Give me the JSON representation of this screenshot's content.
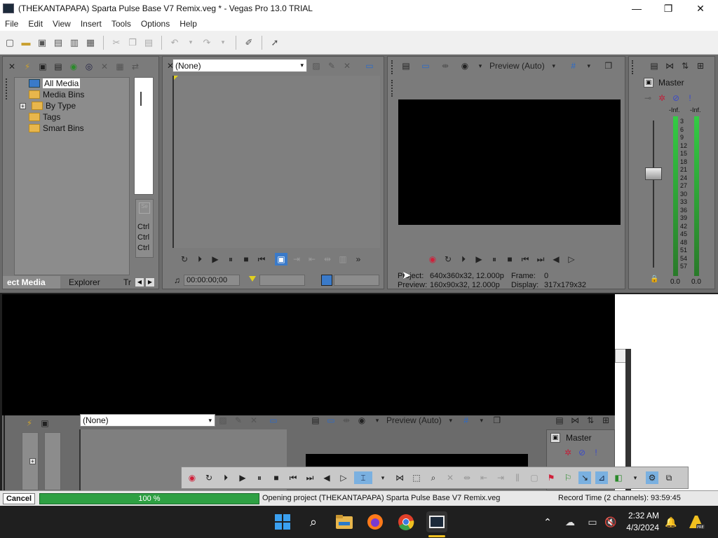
{
  "window": {
    "title": "(THEKANTAPAPA) Sparta Pulse Base V7 Remix.veg * - Vegas Pro 13.0 TRIAL",
    "minimize": "—",
    "maximize": "❐",
    "close": "✕"
  },
  "menu": [
    "File",
    "Edit",
    "View",
    "Insert",
    "Tools",
    "Options",
    "Help"
  ],
  "media_panel": {
    "tree": [
      {
        "label": "All Media",
        "selected": true
      },
      {
        "label": "Media Bins"
      },
      {
        "label": "By Type",
        "expandable": true
      },
      {
        "label": "Tags"
      },
      {
        "label": "Smart Bins"
      }
    ],
    "tabs": [
      "ect Media",
      "Explorer",
      "Tr"
    ],
    "side_items": [
      "Ctrl",
      "Ctrl",
      "Ctrl"
    ]
  },
  "trimmer": {
    "dropdown_value": "(None)",
    "timecode": "00:00:00;00"
  },
  "preview": {
    "quality": "Preview (Auto)",
    "project_label": "Project:",
    "project_value": "640x360x32, 12.000p",
    "preview_label": "Preview:",
    "preview_value": "160x90x32, 12.000p",
    "frame_label": "Frame:",
    "frame_value": "0",
    "display_label": "Display:",
    "display_value": "317x179x32"
  },
  "mixer": {
    "title": "Master",
    "left_peak": "-Inf.",
    "right_peak": "-Inf.",
    "scale": [
      "3",
      "6",
      "9",
      "12",
      "15",
      "18",
      "21",
      "24",
      "27",
      "30",
      "33",
      "36",
      "39",
      "42",
      "45",
      "48",
      "51",
      "54",
      "57"
    ],
    "left_level": "0.0",
    "right_level": "0.0"
  },
  "lower": {
    "dropdown_value": "(None)",
    "quality": "Preview (Auto)",
    "mixer_title": "Master"
  },
  "status": {
    "cancel": "Cancel",
    "progress_text": "100 %",
    "progress_fraction": 1.0,
    "message": "Opening project (THEKANTAPAPA) Sparta Pulse Base V7 Remix.veg",
    "record_time": "Record Time (2 channels): 93:59:45"
  },
  "taskbar": {
    "time": "2:32 AM",
    "date": "4/3/2024"
  },
  "colors": {
    "progress": "#2ea043",
    "panel": "#7b7b7b",
    "taskbar": "#1f1f1f"
  }
}
